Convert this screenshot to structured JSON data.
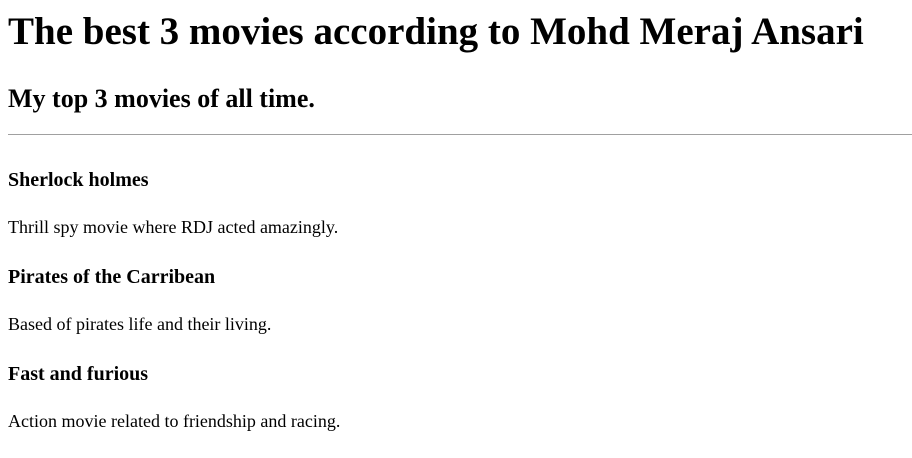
{
  "page": {
    "heading": "The best 3 movies according to Mohd Meraj Ansari",
    "subheading": "My top 3 movies of all time."
  },
  "movies": [
    {
      "title": "Sherlock holmes",
      "description": "Thrill spy movie where RDJ acted amazingly."
    },
    {
      "title": "Pirates of the Carribean",
      "description": "Based of pirates life and their living."
    },
    {
      "title": "Fast and furious",
      "description": "Action movie related to friendship and racing."
    }
  ]
}
